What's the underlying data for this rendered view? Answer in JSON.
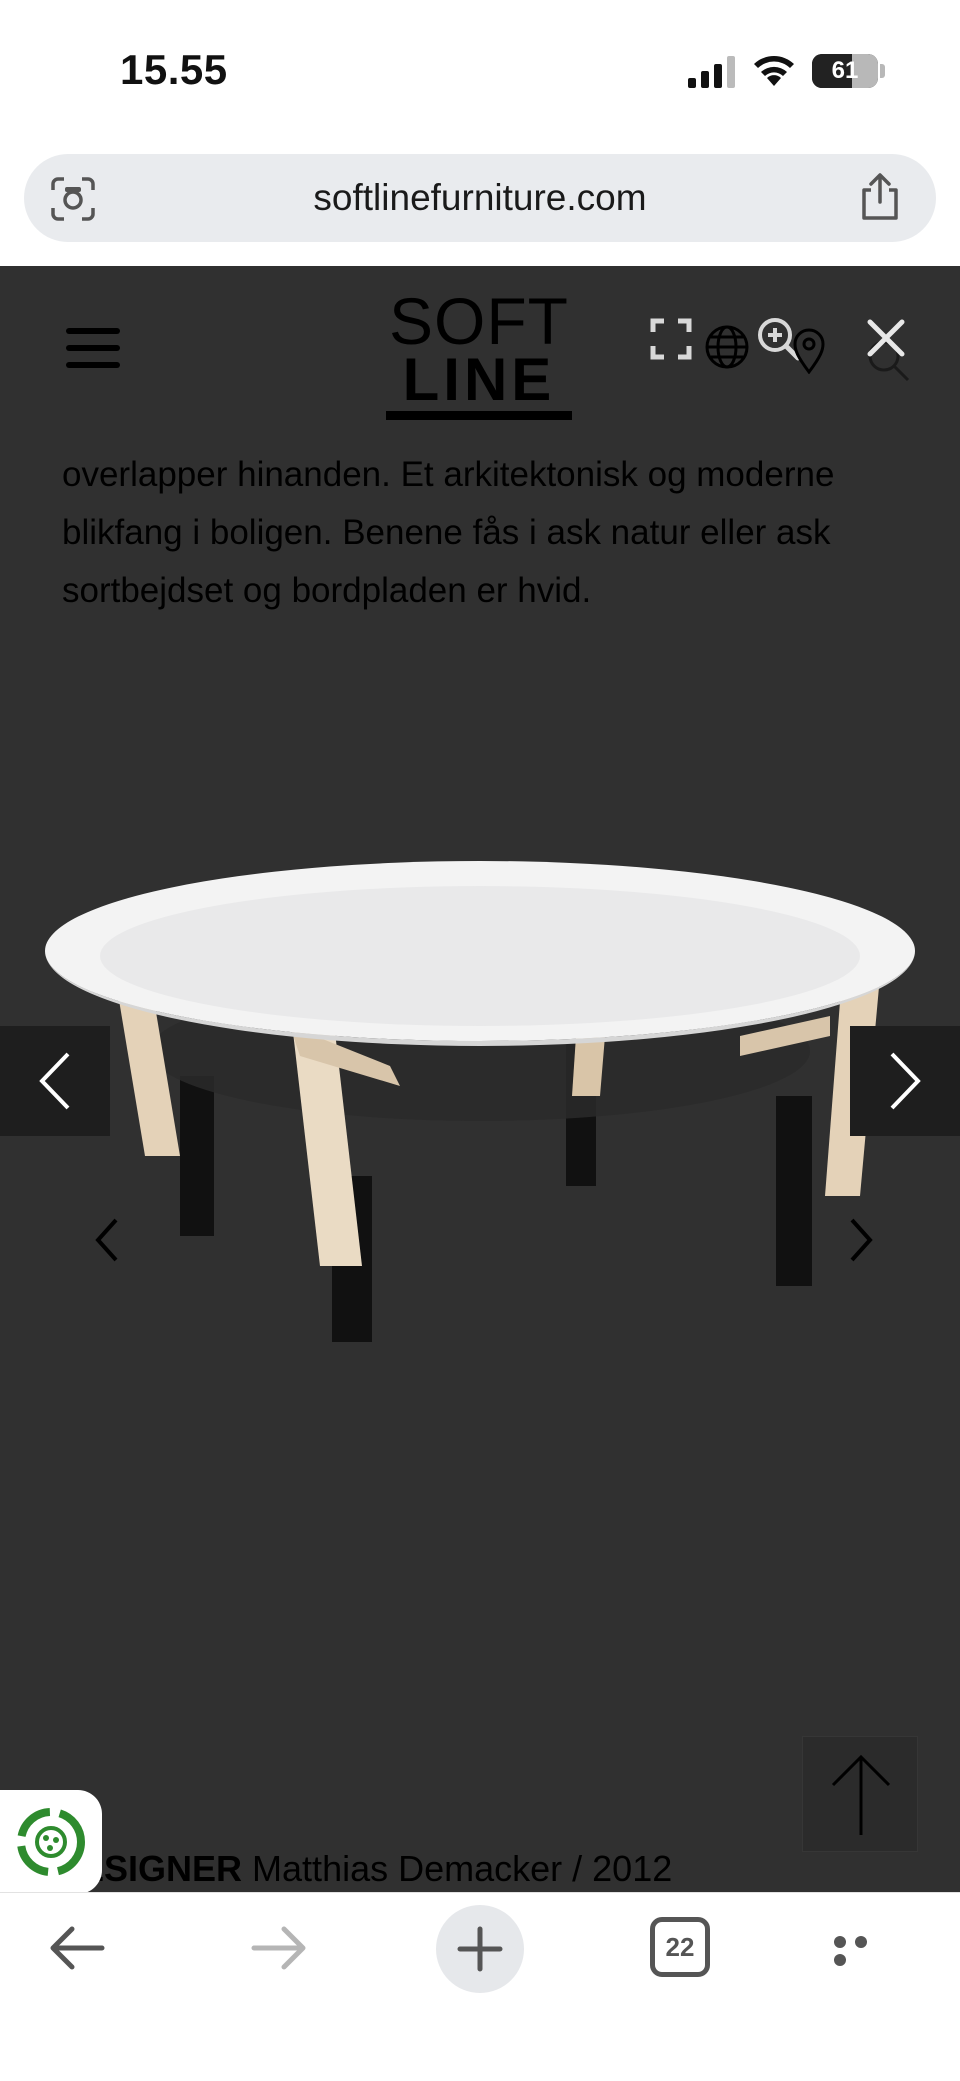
{
  "status_bar": {
    "time": "15.55",
    "battery_level": "61"
  },
  "browser": {
    "url": "softlinefurniture.com",
    "tab_count": "22"
  },
  "site": {
    "logo_line1": "SOFT",
    "logo_line2": "LINE",
    "description": "overlapper hinanden. Et arkitektonisk og moderne blikfang i boligen. Benene fås i ask natur eller ask sortbejdset og bordpladen er hvid.",
    "designer_label": "ESIGNER",
    "designer_value": " Matthias Demacker / 2012"
  },
  "colors": {
    "page_overlay": "#303030",
    "eco_badge_green": "#2e8b2e",
    "browser_bar": "#e9ebee"
  },
  "icons": [
    "scan-icon",
    "share-icon",
    "menu-icon",
    "expand-icon",
    "globe-icon",
    "zoom-in-icon",
    "location-icon",
    "close-icon",
    "search-icon",
    "chevron-left-icon",
    "chevron-right-icon",
    "arrow-up-icon",
    "eco-badge-icon",
    "back-icon",
    "forward-icon",
    "plus-icon",
    "tabs-icon",
    "more-icon"
  ]
}
